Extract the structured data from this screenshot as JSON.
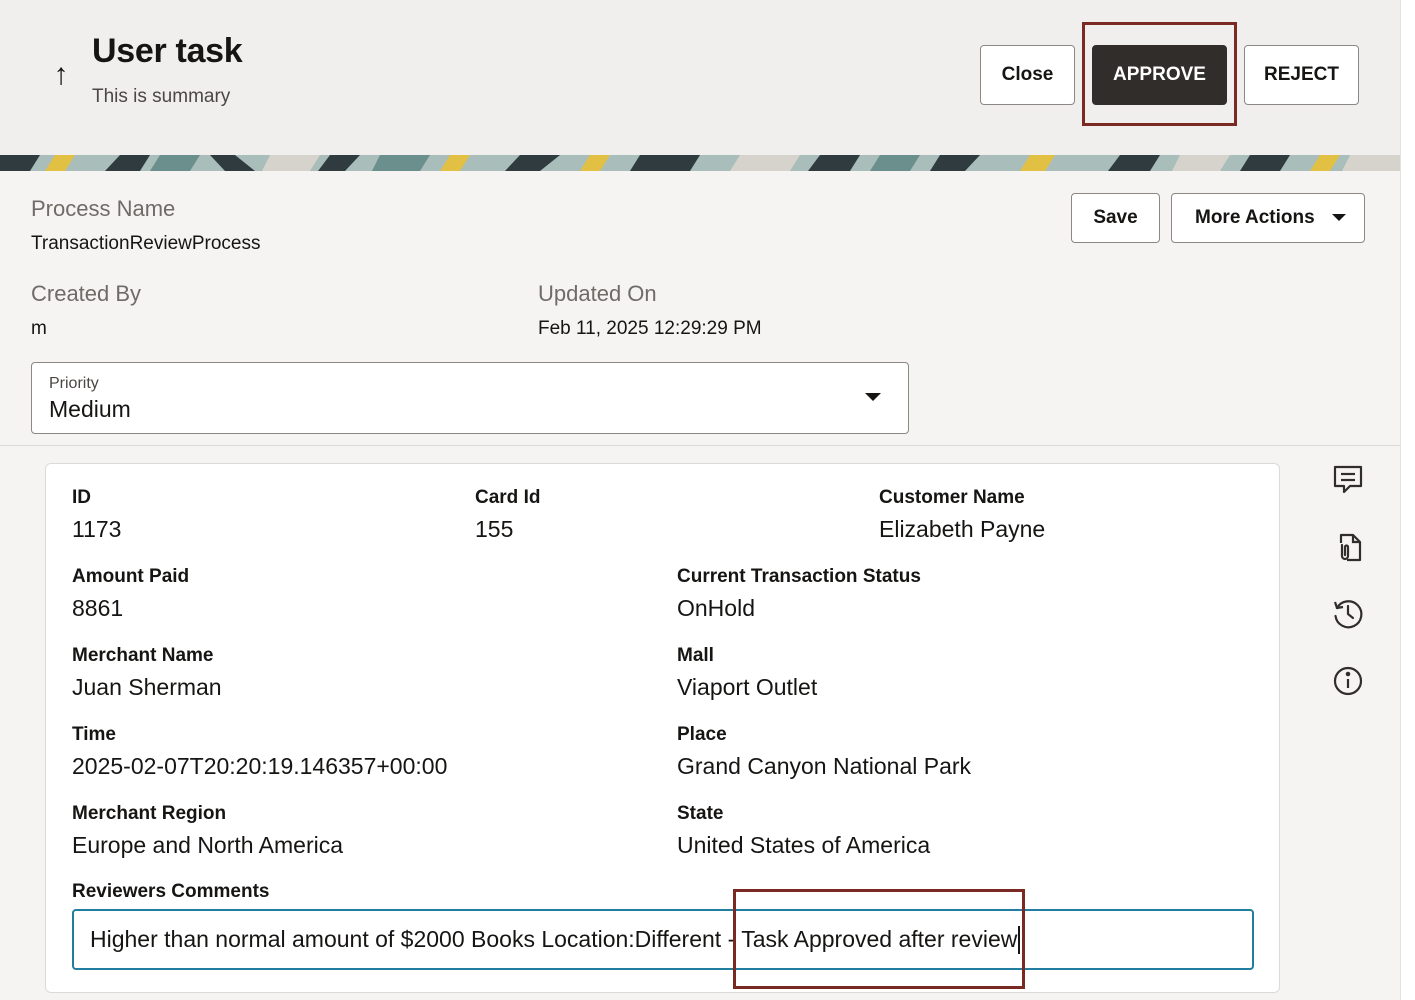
{
  "header": {
    "back_icon": "arrow-up-icon",
    "back_glyph": "↑",
    "title": "User task",
    "subtitle": "This is summary",
    "close_label": "Close",
    "approve_label": "APPROVE",
    "reject_label": "REJECT"
  },
  "details": {
    "process_name_label": "Process Name",
    "process_name_value": "TransactionReviewProcess",
    "created_by_label": "Created By",
    "created_by_value": "m",
    "updated_on_label": "Updated On",
    "updated_on_value": "Feb 11, 2025 12:29:29 PM",
    "save_label": "Save",
    "more_actions_label": "More Actions",
    "priority": {
      "label": "Priority",
      "value": "Medium"
    }
  },
  "form": {
    "id": {
      "label": "ID",
      "value": "1173"
    },
    "card_id": {
      "label": "Card Id",
      "value": "155"
    },
    "customer_name": {
      "label": "Customer Name",
      "value": "Elizabeth Payne"
    },
    "amount_paid": {
      "label": "Amount Paid",
      "value": "8861"
    },
    "current_status": {
      "label": "Current Transaction Status",
      "value": "OnHold"
    },
    "merchant_name": {
      "label": "Merchant Name",
      "value": "Juan Sherman"
    },
    "mall": {
      "label": "Mall",
      "value": "Viaport Outlet"
    },
    "time": {
      "label": "Time",
      "value": "2025-02-07T20:20:19.146357+00:00"
    },
    "place": {
      "label": "Place",
      "value": "Grand Canyon National Park"
    },
    "merchant_region": {
      "label": "Merchant Region",
      "value": "Europe and North America"
    },
    "state": {
      "label": "State",
      "value": "United States of America"
    },
    "reviewers_comments": {
      "label": "Reviewers Comments",
      "value": "Higher than normal amount of $2000 Books Location:Different - Task Approved after review"
    }
  },
  "side_icons": [
    "comments-icon",
    "attachment-icon",
    "history-icon",
    "info-icon"
  ],
  "colors": {
    "approve_bg": "#312d2a",
    "highlight": "#7a2a23",
    "input_focus": "#227e9e"
  }
}
